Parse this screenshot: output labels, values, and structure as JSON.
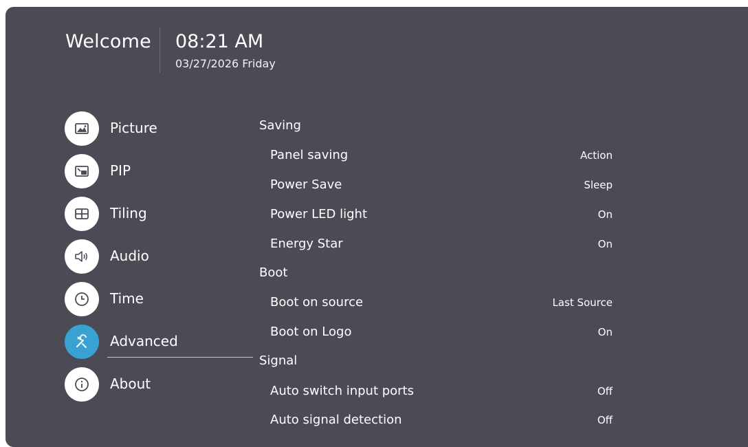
{
  "header": {
    "welcome": "Welcome",
    "time": "08:21 AM",
    "date": "03/27/2026 Friday"
  },
  "nav": {
    "items": [
      {
        "label": "Picture",
        "icon": "picture-icon"
      },
      {
        "label": "PIP",
        "icon": "pip-icon"
      },
      {
        "label": "Tiling",
        "icon": "tiling-icon"
      },
      {
        "label": "Audio",
        "icon": "speaker-icon"
      },
      {
        "label": "Time",
        "icon": "clock-icon"
      },
      {
        "label": "Advanced",
        "icon": "tools-icon",
        "selected": true
      },
      {
        "label": "About",
        "icon": "info-icon"
      }
    ]
  },
  "settings": {
    "saving": {
      "title": "Saving",
      "rows": [
        {
          "label": "Panel saving",
          "value": "Action"
        },
        {
          "label": "Power Save",
          "value": "Sleep"
        },
        {
          "label": "Power LED light",
          "value": "On"
        },
        {
          "label": "Energy Star",
          "value": "On"
        }
      ]
    },
    "boot": {
      "title": "Boot",
      "rows": [
        {
          "label": "Boot on source",
          "value": "Last Source"
        },
        {
          "label": "Boot on Logo",
          "value": "On"
        }
      ]
    },
    "signal": {
      "title": "Signal",
      "rows": [
        {
          "label": "Auto switch input ports",
          "value": "Off"
        },
        {
          "label": "Auto signal detection",
          "value": "Off"
        }
      ]
    }
  },
  "colors": {
    "background": "#4c4b55",
    "accent": "#39a2d3",
    "icon_bg": "#ffffff"
  }
}
